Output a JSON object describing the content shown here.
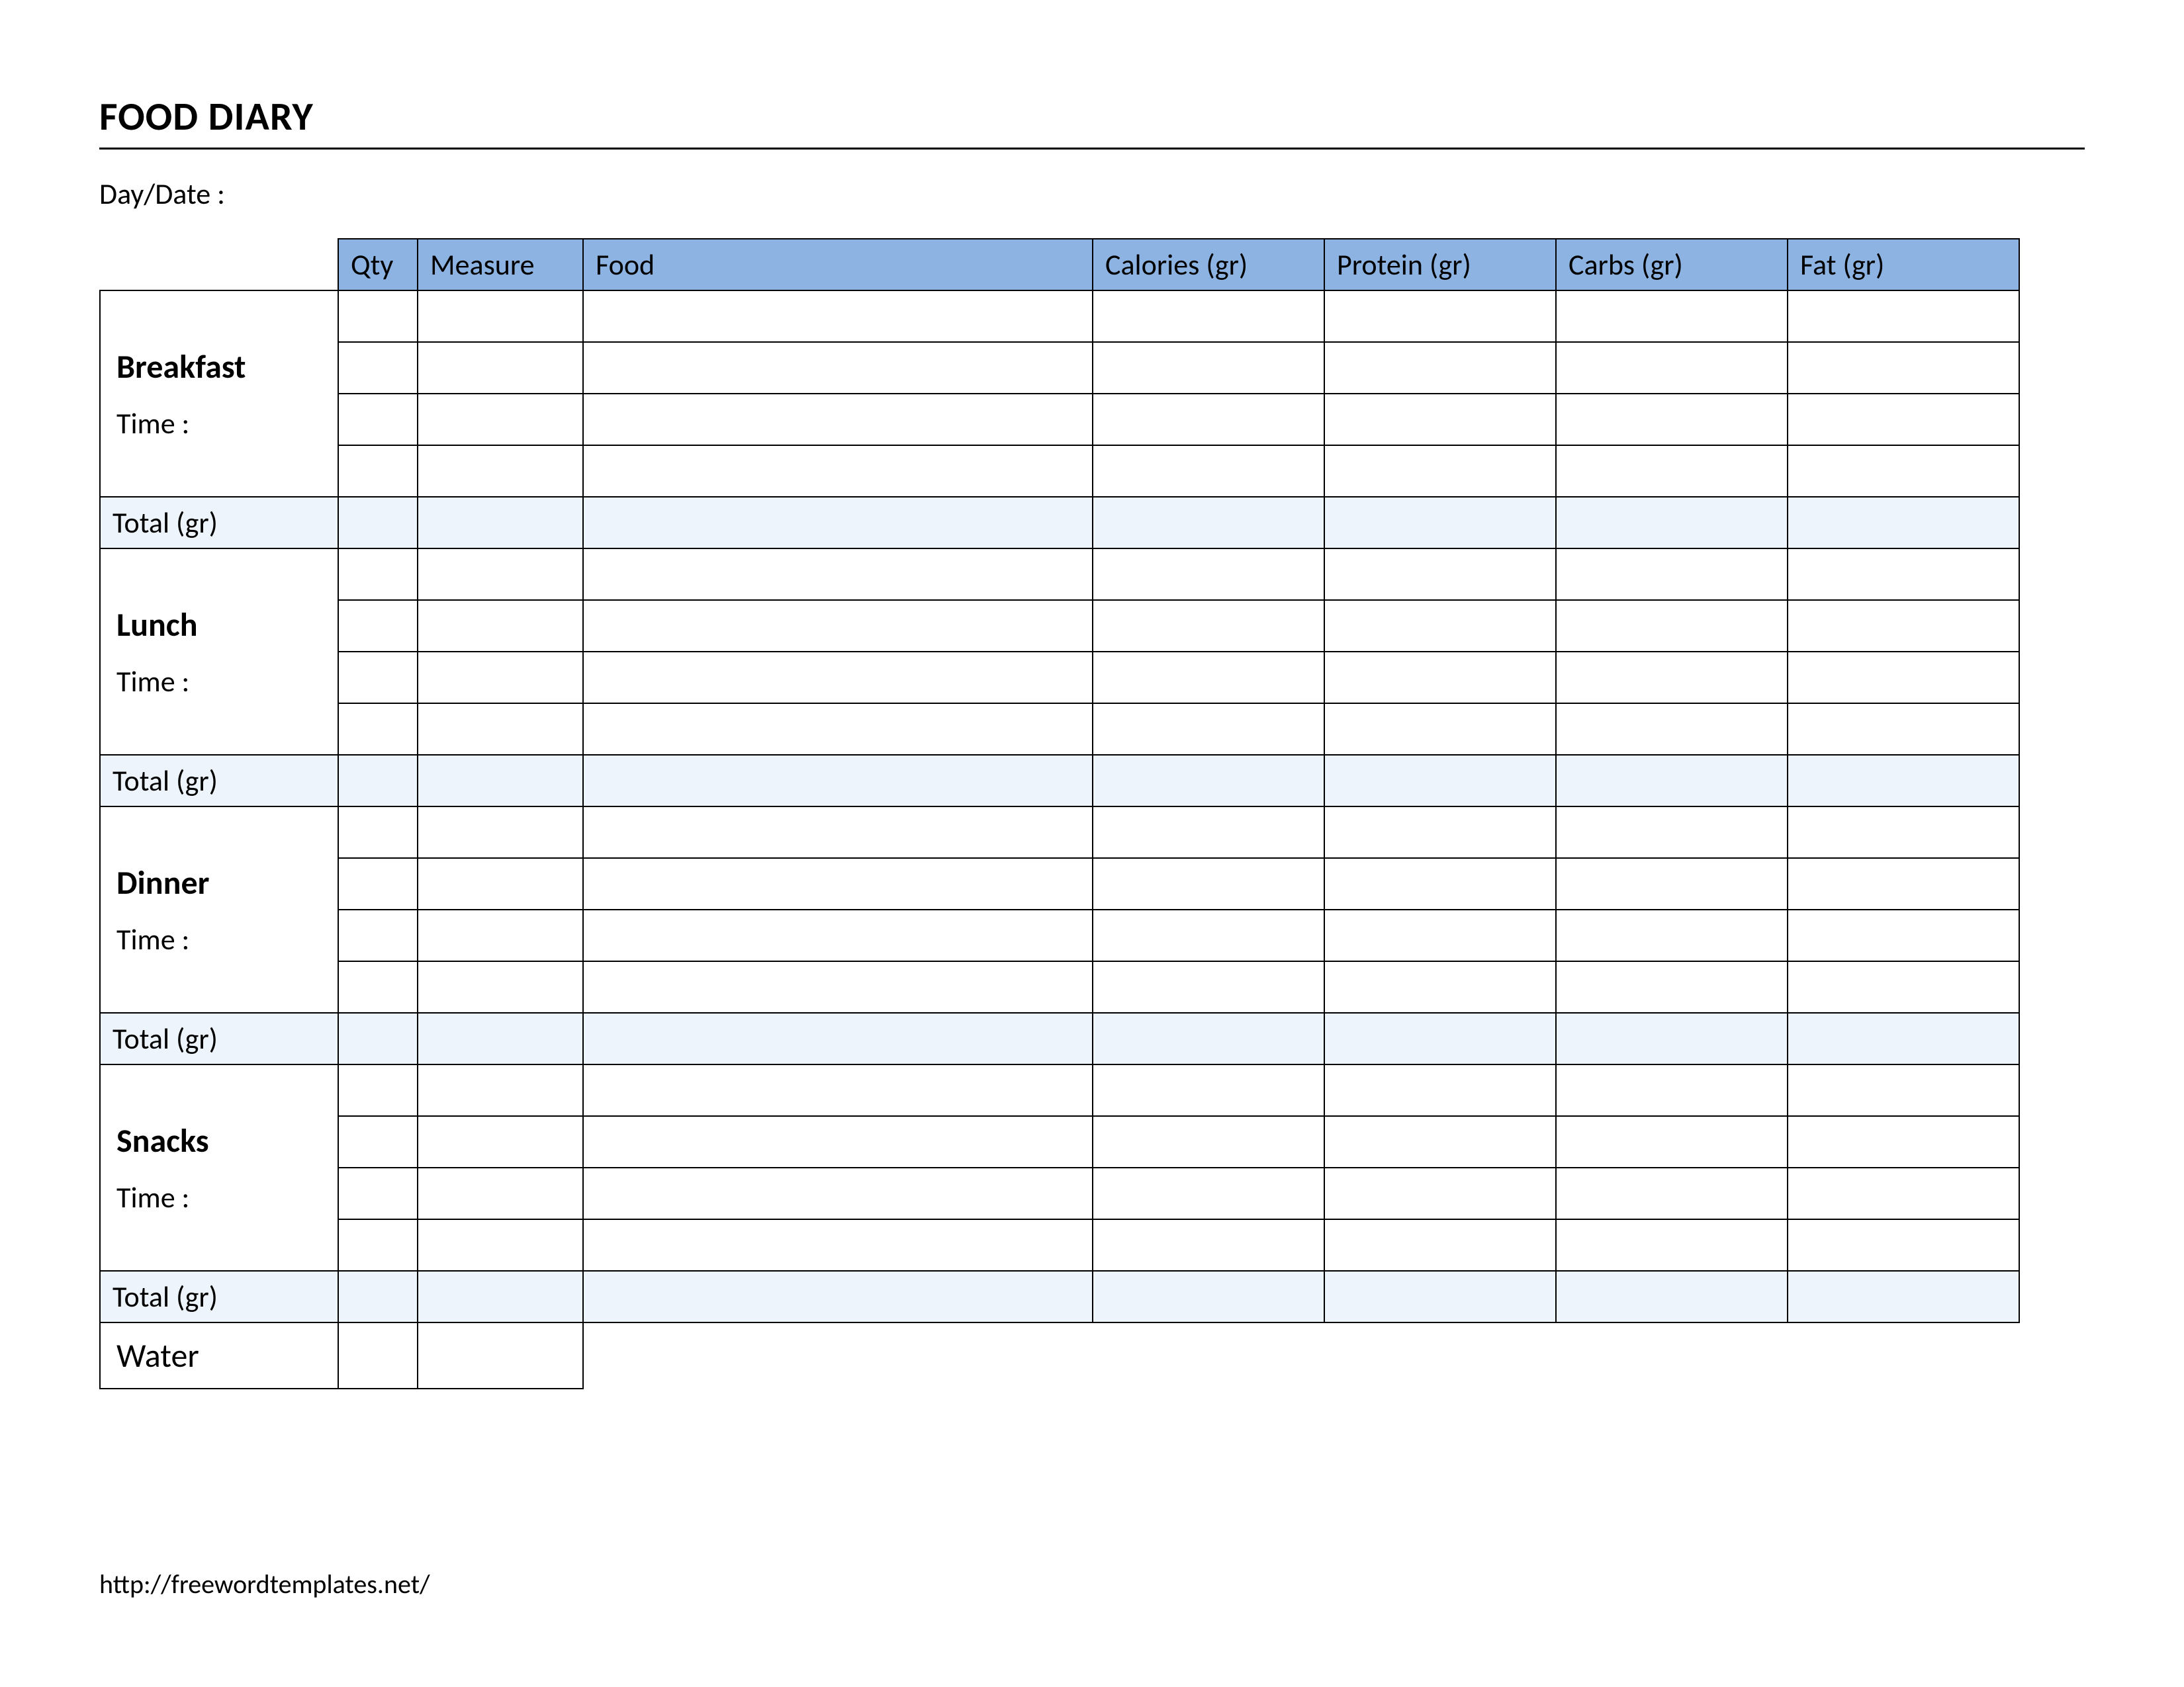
{
  "title": "FOOD DIARY",
  "day_date_label": "Day/Date :",
  "headers": {
    "qty": "Qty",
    "measure": "Measure",
    "food": "Food",
    "calories": "Calories (gr)",
    "protein": "Protein (gr)",
    "carbs": "Carbs (gr)",
    "fat": "Fat (gr)"
  },
  "time_label": "Time :",
  "total_label": "Total (gr)",
  "water_label": "Water",
  "meals": {
    "breakfast": {
      "name": "Breakfast"
    },
    "lunch": {
      "name": "Lunch"
    },
    "dinner": {
      "name": "Dinner"
    },
    "snacks": {
      "name": "Snacks"
    }
  },
  "footer_url": "http://freewordtemplates.net/"
}
